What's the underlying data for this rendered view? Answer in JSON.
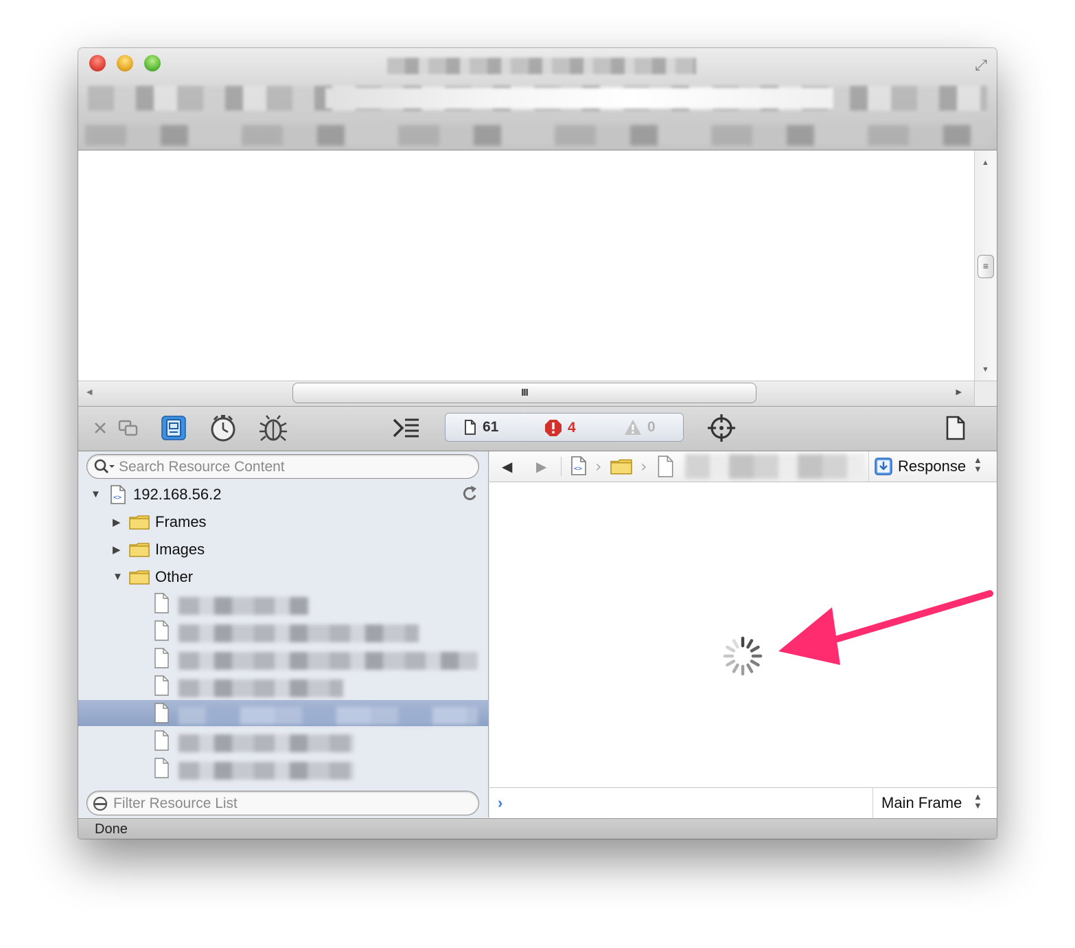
{
  "sidebar": {
    "search_placeholder": "Search Resource Content",
    "tree": {
      "root_label": "192.168.56.2",
      "folders": [
        {
          "label": "Frames",
          "expanded": false
        },
        {
          "label": "Images",
          "expanded": false
        },
        {
          "label": "Other",
          "expanded": true
        }
      ]
    },
    "filter_placeholder": "Filter Resource List"
  },
  "toolbar": {
    "resource_count": "61",
    "error_count": "4",
    "warning_count": "0",
    "icons": [
      "close-icon",
      "undock-icon",
      "resources-icon",
      "timelines-icon",
      "debugger-icon",
      "console-icon",
      "inspect-icon",
      "details-sidebar-icon"
    ]
  },
  "content": {
    "response_label": "Response",
    "frame_label": "Main Frame"
  },
  "status": {
    "text": "Done"
  },
  "colors": {
    "selection": "#8ea2c6",
    "error": "#d2312b",
    "annotation_arrow": "#ff2d6f",
    "console_prompt": "#3a7de0"
  }
}
